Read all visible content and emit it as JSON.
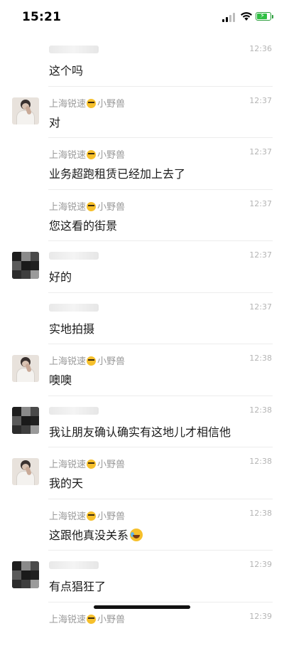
{
  "status_bar": {
    "time": "15:21"
  },
  "sender_name": "上海锐速",
  "sender_suffix": "小野兽",
  "messages": [
    {
      "sender": "blurred",
      "time": "12:36",
      "text": "这个吗",
      "avatar": "none",
      "first": true
    },
    {
      "sender": "named",
      "time": "12:37",
      "text": "对",
      "avatar": "photo"
    },
    {
      "sender": "named",
      "time": "12:37",
      "text": "业务超跑租赁已经加上去了",
      "avatar": "none"
    },
    {
      "sender": "named",
      "time": "12:37",
      "text": "您这看的街景",
      "avatar": "none"
    },
    {
      "sender": "blurred",
      "time": "12:37",
      "text": "好的",
      "avatar": "pixelated"
    },
    {
      "sender": "blurred",
      "time": "12:37",
      "text": "实地拍摄",
      "avatar": "none"
    },
    {
      "sender": "named",
      "time": "12:38",
      "text": "噢噢",
      "avatar": "photo"
    },
    {
      "sender": "blurred",
      "time": "12:38",
      "text": "我让朋友确认确实有这地儿才相信他",
      "avatar": "pixelated"
    },
    {
      "sender": "named",
      "time": "12:38",
      "text": "我的天",
      "avatar": "photo"
    },
    {
      "sender": "named",
      "time": "12:38",
      "text": "这跟他真没关系",
      "avatar": "none",
      "trailing_emoji": "laughing-crying-emoji"
    },
    {
      "sender": "blurred",
      "time": "12:39",
      "text": "有点猖狂了",
      "avatar": "pixelated"
    },
    {
      "sender": "named",
      "time": "12:39",
      "text": "",
      "avatar": "none"
    }
  ]
}
